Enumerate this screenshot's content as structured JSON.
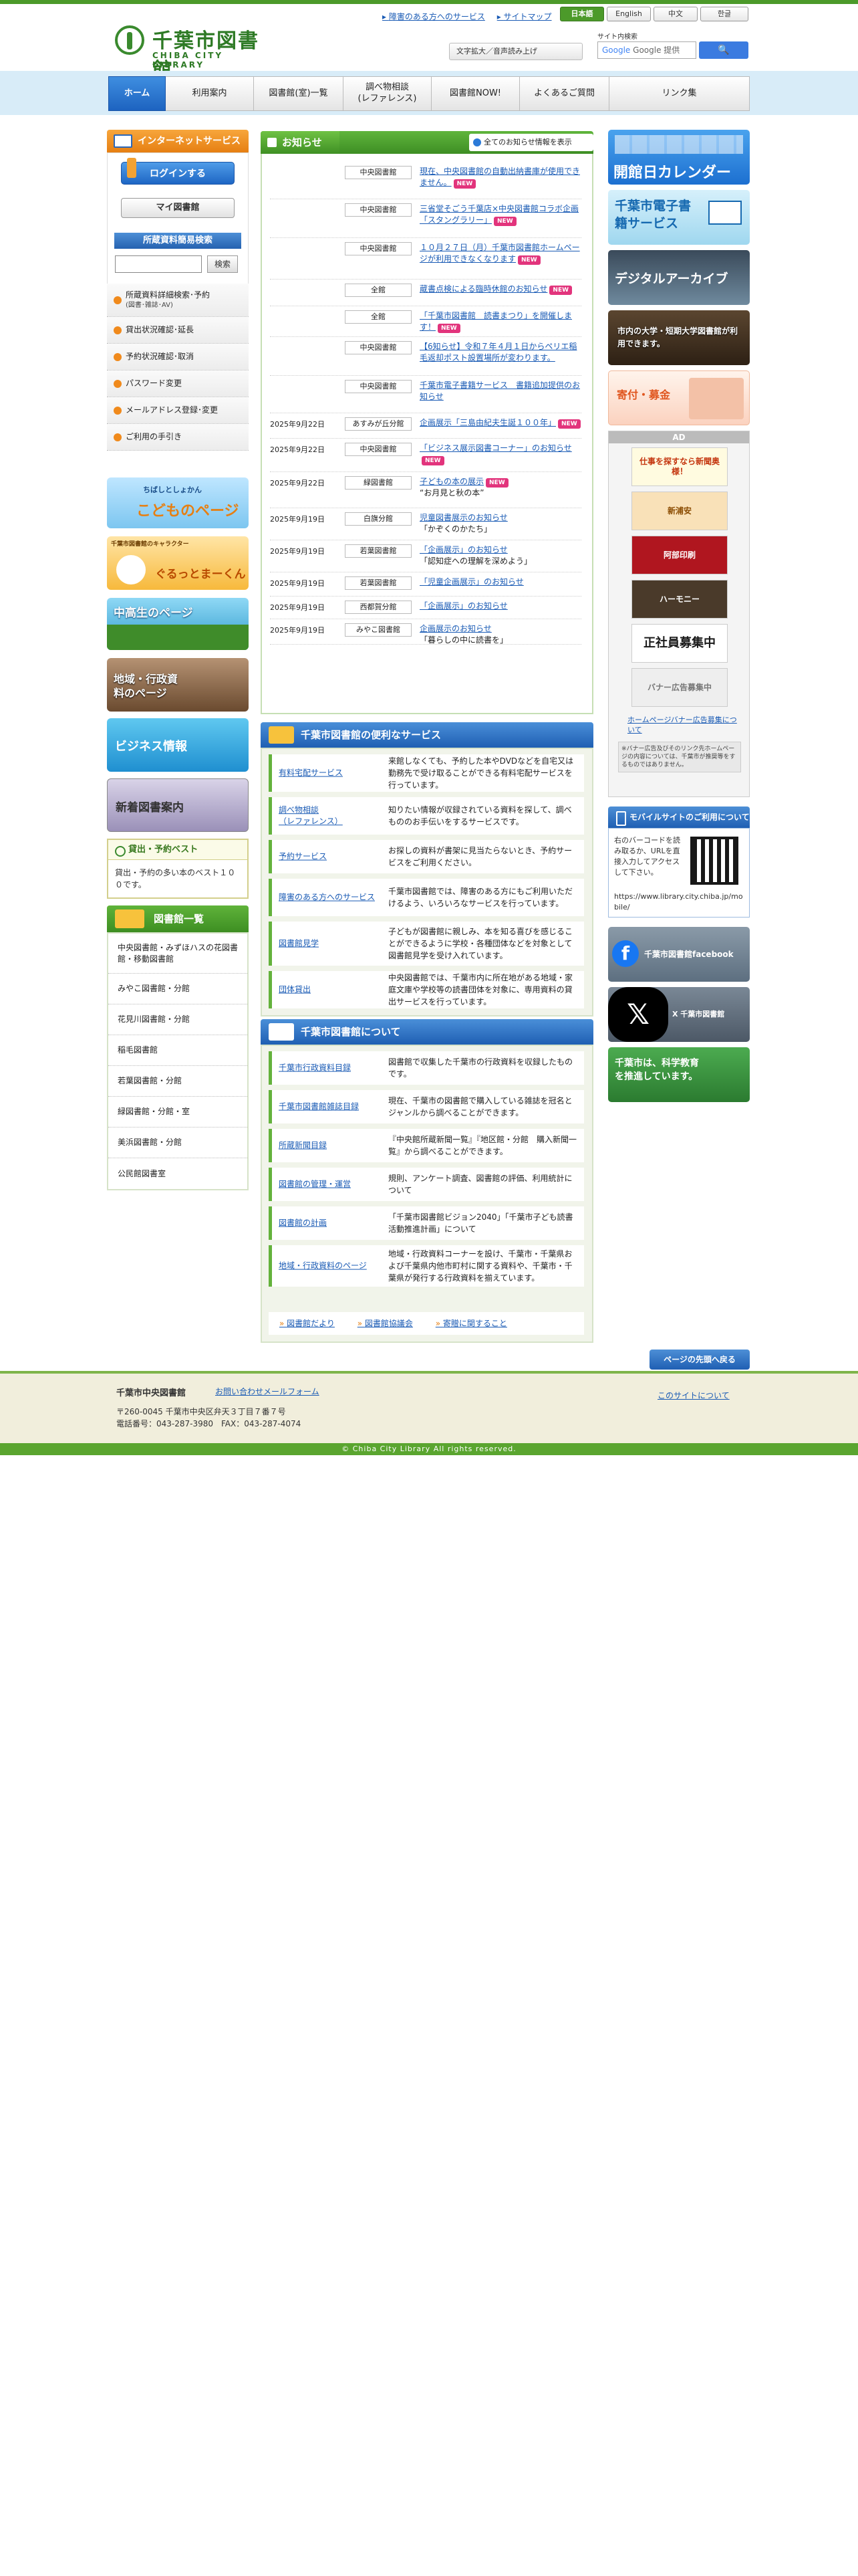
{
  "header": {
    "logo_jp": "千葉市図書館",
    "logo_en": "CHIBA CITY LIBRARY",
    "links": [
      "障害のある方へのサービス",
      "サイトマップ"
    ],
    "languages": [
      "日本語",
      "English",
      "中文",
      "한글"
    ],
    "accessibility": "文字拡大／音声読み上げ",
    "site_search_label": "サイト内検索",
    "search_placeholder": "Google 提供",
    "search_button": "🔍"
  },
  "nav": [
    "ホーム",
    "利用案内",
    "図書館(室)一覧",
    "調べ物相談\n(レファレンス)",
    "図書館NOW!",
    "よくあるご質問",
    "リンク集"
  ],
  "left": {
    "internet_service": "インターネットサービス",
    "login": "ログインする",
    "mylibrary": "マイ図書館",
    "simple_search": "所蔵資料簡易検索",
    "search_button": "検索",
    "menu": [
      {
        "label": "所蔵資料詳細検索･予約",
        "sub": "(図書･雑誌･AV)"
      },
      {
        "label": "貸出状況確認･延長",
        "sub": ""
      },
      {
        "label": "予約状況確認･取消",
        "sub": ""
      },
      {
        "label": "パスワード変更",
        "sub": ""
      },
      {
        "label": "メールアドレス登録･変更",
        "sub": ""
      },
      {
        "label": "ご利用の手引き",
        "sub": ""
      }
    ],
    "banners": [
      {
        "label": "こどものページ",
        "sub": "ちばしとしょかん"
      },
      {
        "label": "ぐるっとまーくん",
        "sub": "千葉市図書館のキャラクター"
      },
      {
        "label": "中高生のページ",
        "sub": ""
      },
      {
        "label": "地域・行政資料のページ",
        "sub": ""
      },
      {
        "label": "ビジネス情報",
        "sub": ""
      },
      {
        "label": "新着図書案内",
        "sub": ""
      }
    ],
    "best_title": "貸出・予約ベスト",
    "best_body": "貸出・予約の多い本のベスト１００です。",
    "libraries_title": "図書館一覧",
    "libraries": [
      "中央図書館・みずほハスの花図書館・移動図書館",
      "みやこ図書館・分館",
      "花見川図書館・分館",
      "稲毛図書館",
      "若葉図書館・分館",
      "緑図書館・分館・室",
      "美浜図書館・分館",
      "公民館図書室"
    ]
  },
  "news": {
    "title": "お知らせ",
    "all_link": "全てのお知らせ情報を表示",
    "items": [
      {
        "date": "",
        "lib": "中央図書館",
        "text": "現在、中央図書館の自動出納書庫が使用できません。",
        "note": "",
        "new": true
      },
      {
        "date": "",
        "lib": "中央図書館",
        "text": "三省堂そごう千葉店×中央図書館コラボ企画「スタングラリー」",
        "note": "",
        "new": true
      },
      {
        "date": "",
        "lib": "中央図書館",
        "text": "１０月２７日（月）千葉市図書館ホームページが利用できなくなります",
        "note": "",
        "new": true
      },
      {
        "date": "",
        "lib": "全館",
        "text": "蔵書点検による臨時休館のお知らせ",
        "note": "",
        "new": true
      },
      {
        "date": "",
        "lib": "全館",
        "text": "「千葉市図書館　読書まつり」を開催します！",
        "note": "",
        "new": true
      },
      {
        "date": "",
        "lib": "中央図書館",
        "text": "【6知らせ】令和７年４月１日からペリエ稲毛返却ポスト設置場所が変わります。",
        "note": "",
        "new": false
      },
      {
        "date": "",
        "lib": "中央図書館",
        "text": "千葉市電子書籍サービス　書籍追加提供のお知らせ",
        "note": "",
        "new": false
      },
      {
        "date": "2025年9月22日",
        "lib": "あすみが丘分館",
        "text": "企画展示「三島由紀夫生誕１００年」",
        "note": "",
        "new": true
      },
      {
        "date": "2025年9月22日",
        "lib": "中央図書館",
        "text": "「ビジネス展示図書コーナー」のお知らせ",
        "note": "",
        "new": true
      },
      {
        "date": "2025年9月22日",
        "lib": "緑図書館",
        "text": "子どもの本の展示",
        "note": "“お月見と秋の本”",
        "new": true
      },
      {
        "date": "2025年9月19日",
        "lib": "白旗分館",
        "text": "児童図書展示のお知らせ",
        "note": "「かぞくのかたち」",
        "new": false
      },
      {
        "date": "2025年9月19日",
        "lib": "若葉図書館",
        "text": "「企画展示」のお知らせ",
        "note": "「認知症への理解を深めよう」",
        "new": false
      },
      {
        "date": "2025年9月19日",
        "lib": "若葉図書館",
        "text": "「児童企画展示」のお知らせ",
        "note": "",
        "new": false
      },
      {
        "date": "2025年9月19日",
        "lib": "西都賀分館",
        "text": "「企画展示」のお知らせ",
        "note": "",
        "new": false
      },
      {
        "date": "2025年9月19日",
        "lib": "みやこ図書館",
        "text": "企画展示のお知らせ",
        "note": "「暮らしの中に読書を」",
        "new": false
      }
    ]
  },
  "services": {
    "title": "千葉市図書館の便利なサービス",
    "items": [
      {
        "name": "有料宅配サービス",
        "desc": "来館しなくても、予約した本やDVDなどを自宅又は勤務先で受け取ることができる有料宅配サービスを行っています。"
      },
      {
        "name": "調べ物相談\n（レファレンス）",
        "desc": "知りたい情報が収録されている資料を探して、調べもののお手伝いをするサービスです。"
      },
      {
        "name": "予約サービス",
        "desc": "お探しの資料が書架に見当たらないとき、予約サービスをご利用ください。"
      },
      {
        "name": "障害のある方へのサービス",
        "desc": "千葉市図書館では、障害のある方にもご利用いただけるよう、いろいろなサービスを行っています。"
      },
      {
        "name": "図書館見学",
        "desc": "子どもが図書館に親しみ、本を知る喜びを感じることができるように学校・各種団体などを対象として図書館見学を受け入れています。"
      },
      {
        "name": "団体貸出",
        "desc": "中央図書館では、千葉市内に所在地がある地域・家庭文庫や学校等の読書団体を対象に、専用資料の貸出サービスを行っています。"
      }
    ]
  },
  "about": {
    "title": "千葉市図書館について",
    "items": [
      {
        "name": "千葉市行政資料目録",
        "desc": "図書館で収集した千葉市の行政資料を収録したものです。"
      },
      {
        "name": "千葉市図書館雑誌目録",
        "desc": "現在、千葉市の図書館で購入している雑誌を冠名とジャンルから調べることができます。"
      },
      {
        "name": "所蔵新聞目録",
        "desc": "『中央館所蔵新聞一覧』『地区館・分館　購入新聞一覧』から調べることができます。"
      },
      {
        "name": "図書館の管理・運営",
        "desc": "規則、アンケート調査、図書館の評価、利用統計について"
      },
      {
        "name": "図書館の計画",
        "desc": "「千葉市図書館ビジョン2040」「千葉市子ども読書活動推進計画」について"
      },
      {
        "name": "地域・行政資料のページ",
        "desc": "地域・行政資料コーナーを設け、千葉市・千葉県および千葉県内他市町村に関する資料や、千葉市・千葉県が発行する行政資料を揃えています。"
      }
    ],
    "links": [
      "図書館だより",
      "図書館協議会",
      "寄贈に関すること"
    ]
  },
  "right": {
    "banners": [
      "開館日カレンダー",
      "千葉市電子書籍サービス",
      "デジタルアーカイブ",
      "市内の大学・短期大学図書館が利用できます。",
      "寄付・募金"
    ],
    "ad_title": "AD",
    "ads": [
      "仕事を探すなら新聞奥様！",
      "新浦安",
      "阿部印刷",
      "ハーモニー",
      "正社員募集中",
      "バナー広告募集中"
    ],
    "ad_link": "ホームページバナー広告募集について",
    "ad_note": "※バナー広告及びそのリンク先ホームページの内容については、千葉市が推奨等をするものではありません。",
    "mobile_title": "モバイルサイトのご利用について",
    "mobile_text": "右のバーコードを読み取るか、URLを直接入力してアクセスして下さい。",
    "mobile_url": "https://www.library.city.chiba.jp/mobile/",
    "social": [
      "千葉市図書館facebook",
      "X 千葉市図書館",
      "千葉市は、科学教育を推進しています。"
    ]
  },
  "footer": {
    "pagetop": "ページの先頭へ戻る",
    "name": "千葉市中央図書館",
    "contact": "お問い合わせメールフォーム",
    "address": "〒260-0045 千葉市中央区弁天３丁目７番７号",
    "tel": "電話番号：043-287-3980　FAX：043-287-4074",
    "about_site": "このサイトについて",
    "copyright": "© Chiba City Library All rights reserved."
  }
}
